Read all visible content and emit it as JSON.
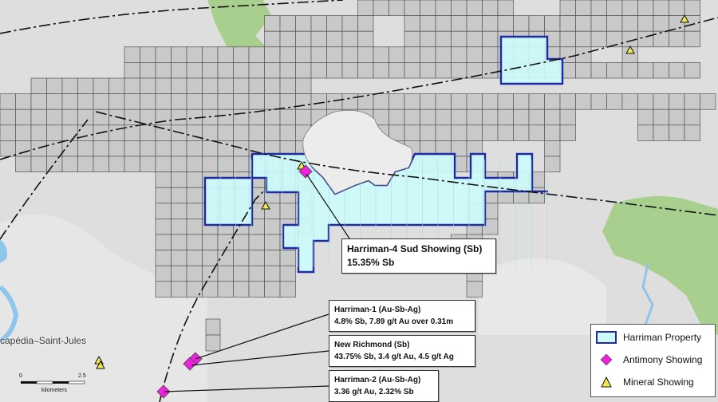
{
  "legend": {
    "property_label": "Harriman Property",
    "antimony_label": "Antimony Showing",
    "mineral_label": "Mineral Showing"
  },
  "colors": {
    "property_fill": "#cdfafa",
    "property_outline": "#1f2aa5",
    "claim_fill": "#c9c9c9",
    "antimony": "#ee22dd",
    "mineral": "#f3e84a",
    "forest": "#a9cf8f",
    "water": "#8ec6ea"
  },
  "callouts": {
    "sud": {
      "title": "Harriman-4 Sud Showing (Sb)",
      "detail": "15.35% Sb"
    },
    "h1": {
      "title": "Harriman-1 (Au-Sb-Ag)",
      "detail": "4.8% Sb, 7.89 g/t Au over 0.31m"
    },
    "nr": {
      "title": "New Richmond (Sb)",
      "detail": "43.75% Sb, 3.4 g/t Au, 4.5 g/t Ag"
    },
    "h2": {
      "title": "Harriman-2 (Au-Sb-Ag)",
      "detail": "3.36 g/t Au, 2.32% Sb"
    }
  },
  "town": "capédia–Saint-Jules",
  "scale": {
    "zero": "0",
    "mid": "2.5",
    "unit": "kilometers"
  }
}
